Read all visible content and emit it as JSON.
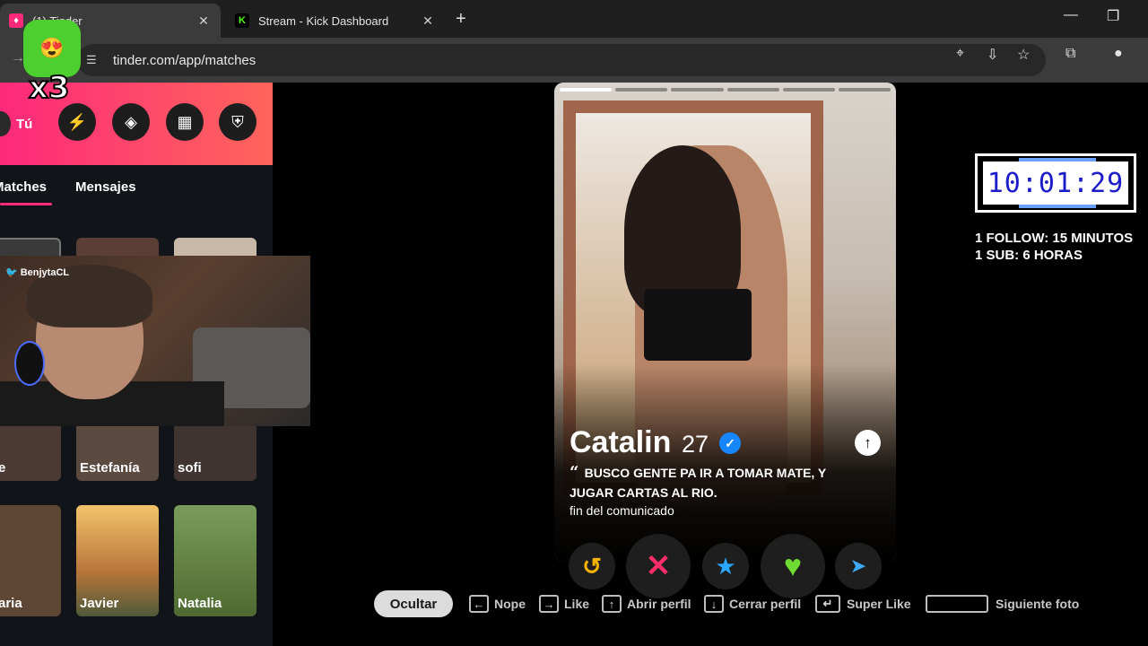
{
  "browser": {
    "tabs": [
      {
        "title": "(1) Tinder",
        "favicon": "tinder-flame-icon",
        "active": true
      },
      {
        "title": "Stream - Kick Dashboard",
        "favicon": "kick-k-icon",
        "active": false
      }
    ],
    "new_tab": "+",
    "tab_close": "✕",
    "url": "tinder.com/app/matches"
  },
  "overlay": {
    "sticker_emoji": "😍",
    "sticker_multiplier": "x3"
  },
  "sidebar": {
    "user_label": "Tú",
    "header_icons": [
      "boost-icon",
      "explore-icon",
      "briefcase-icon",
      "shield-icon"
    ],
    "tabs": [
      {
        "label": "Matches",
        "active": true
      },
      {
        "label": "Mensajes",
        "active": false
      }
    ],
    "thumbnails": [
      {
        "name": "",
        "color": "#3a3a3a"
      },
      {
        "name": "",
        "color": "#5b3f36"
      },
      {
        "name": "",
        "color": "#c8b8a8"
      },
      {
        "name": "e",
        "color": "#4b3a33"
      },
      {
        "name": "Estefanía",
        "color": "#5a4a40"
      },
      {
        "name": "sofi",
        "color": "#3f3430"
      },
      {
        "name": "aria",
        "color": "#5d4634"
      },
      {
        "name": "Javier",
        "color": "#d69a52"
      },
      {
        "name": "Natalia",
        "color": "#5e7b3e"
      }
    ]
  },
  "webcam": {
    "handle": "BenjytaCL"
  },
  "profile": {
    "name": "Catalin",
    "age": "27",
    "bio_line": "BUSCO GENTE PA IR A TOMAR MATE, Y JUGAR CARTAS AL RIO.",
    "bio_sub": "fin del comunicado",
    "photo_count": 6,
    "photo_index": 1
  },
  "actions": [
    {
      "name": "rewind",
      "glyph": "↺",
      "color": "#f7b500"
    },
    {
      "name": "nope",
      "glyph": "✕",
      "color": "#ff2d6a"
    },
    {
      "name": "super-like",
      "glyph": "★",
      "color": "#2aa8ff"
    },
    {
      "name": "like",
      "glyph": "♥",
      "color": "#6fdc33"
    },
    {
      "name": "boost",
      "glyph": "➤",
      "color": "#3fa9ff"
    }
  ],
  "shortcuts": {
    "hide": "Ocultar",
    "items": [
      {
        "key": "←",
        "label": "Nope"
      },
      {
        "key": "→",
        "label": "Like"
      },
      {
        "key": "↑",
        "label": "Abrir perfil"
      },
      {
        "key": "↓",
        "label": "Cerrar perfil"
      },
      {
        "key": "↵",
        "label": "Super Like"
      },
      {
        "key": "",
        "label": "Siguiente foto"
      }
    ]
  },
  "stream_overlay": {
    "timer": "10:01:29",
    "rule1": "1 FOLLOW: 15 MINUTOS",
    "rule2": "1 SUB: 6 HORAS"
  }
}
